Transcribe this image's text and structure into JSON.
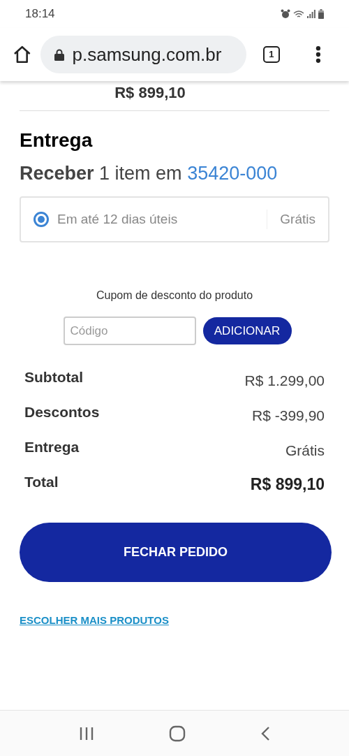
{
  "status_bar": {
    "time": "18:14"
  },
  "browser": {
    "url": "p.samsung.com.br",
    "tab_count": "1"
  },
  "cut_price": "R$ 899,10",
  "delivery": {
    "title": "Entrega",
    "receive_bold": "Receber",
    "receive_text": "1 item em",
    "zip": "35420-000",
    "options": [
      {
        "label": "Em até 12 dias úteis",
        "price": "Grátis",
        "selected": true
      }
    ]
  },
  "coupon": {
    "label": "Cupom de desconto do produto",
    "placeholder": "Código",
    "button": "ADICIONAR"
  },
  "summary": [
    {
      "label": "Subtotal",
      "value": "R$ 1.299,00",
      "kind": "normal"
    },
    {
      "label": "Descontos",
      "value": "R$ -399,90",
      "kind": "normal"
    },
    {
      "label": "Entrega",
      "value": "Grátis",
      "kind": "normal"
    },
    {
      "label": "Total",
      "value": "R$ 899,10",
      "kind": "total"
    }
  ],
  "checkout_button": "FECHAR PEDIDO",
  "more_link": "ESCOLHER MAIS PRODUTOS"
}
